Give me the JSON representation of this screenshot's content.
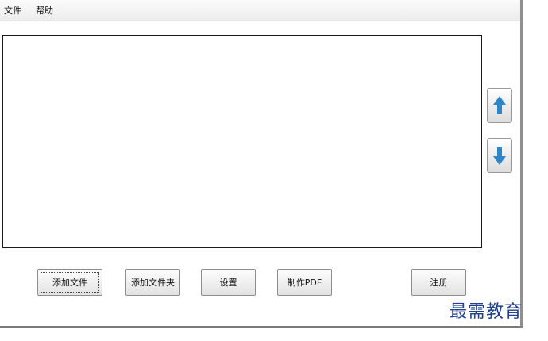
{
  "menu": {
    "file": "文件",
    "help": "帮助"
  },
  "buttons": {
    "add_file": "添加文件",
    "add_folder": "添加文件夹",
    "settings": "设置",
    "make_pdf": "制作PDF",
    "register": "注册"
  },
  "icons": {
    "move_up": "arrow-up-icon",
    "move_down": "arrow-down-icon"
  },
  "colors": {
    "arrow": "#2e86c9",
    "watermark": "#1f3f8f"
  },
  "watermark": "最需教育"
}
